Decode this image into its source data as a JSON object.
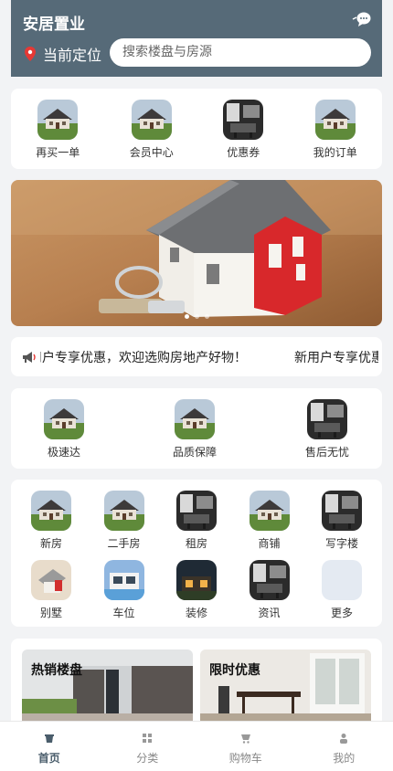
{
  "header": {
    "title": "安居置业",
    "location_label": "当前定位",
    "search_placeholder": "搜索楼盘与房源",
    "icons": {
      "location": "map-pin-icon",
      "message": "chat-bubble-icon"
    }
  },
  "quick_menu": [
    {
      "label": "再买一单",
      "icon": "house-photo"
    },
    {
      "label": "会员中心",
      "icon": "house-photo"
    },
    {
      "label": "优惠券",
      "icon": "interior-photo"
    },
    {
      "label": "我的订单",
      "icon": "house-photo"
    }
  ],
  "banner": {
    "slides": 3,
    "active_slide": 1
  },
  "notice": {
    "icon": "megaphone-icon",
    "text": "新用户专享优惠，欢迎选购房地产好物！"
  },
  "services": [
    {
      "label": "极速达",
      "icon": "house-photo"
    },
    {
      "label": "品质保障",
      "icon": "house-photo"
    },
    {
      "label": "售后无忧",
      "icon": "interior-photo"
    }
  ],
  "categories": [
    {
      "label": "新房",
      "icon": "house-photo"
    },
    {
      "label": "二手房",
      "icon": "house-photo"
    },
    {
      "label": "租房",
      "icon": "interior-photo"
    },
    {
      "label": "商铺",
      "icon": "house-photo"
    },
    {
      "label": "写字楼",
      "icon": "interior-photo"
    },
    {
      "label": "别墅",
      "icon": "house-model-photo"
    },
    {
      "label": "车位",
      "icon": "modern-house-photo"
    },
    {
      "label": "装修",
      "icon": "house-night-photo"
    },
    {
      "label": "资讯",
      "icon": "interior-photo"
    },
    {
      "label": "更多",
      "icon": "blank-tile"
    }
  ],
  "promotions": [
    {
      "title": "热销楼盘"
    },
    {
      "title": "限时优惠"
    }
  ],
  "tabbar": [
    {
      "label": "首页",
      "icon": "home-icon",
      "active": true
    },
    {
      "label": "分类",
      "icon": "grid-icon",
      "active": false
    },
    {
      "label": "购物车",
      "icon": "cart-icon",
      "active": false
    },
    {
      "label": "我的",
      "icon": "user-icon",
      "active": false
    }
  ],
  "colors": {
    "header_bg": "#566a78",
    "page_bg": "#f2f3f5",
    "active_tab": "#4a5d6b",
    "inactive_tab": "#888888"
  }
}
